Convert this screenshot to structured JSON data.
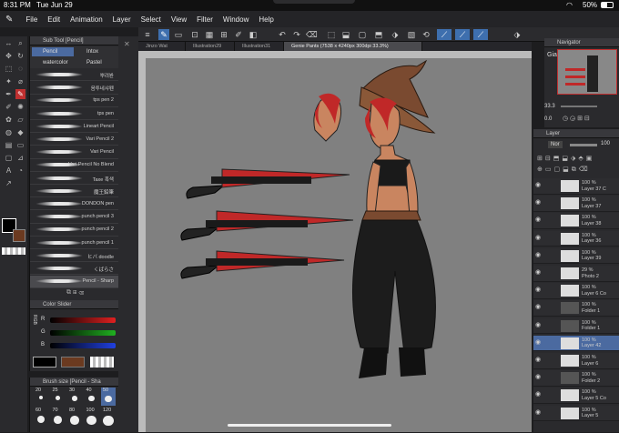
{
  "status": {
    "time": "8:31 PM",
    "date": "Tue Jun 29",
    "battery": "50%"
  },
  "menu": [
    "File",
    "Edit",
    "Animation",
    "Layer",
    "Select",
    "View",
    "Filter",
    "Window",
    "Help"
  ],
  "subtool": {
    "title": "Sub Tool [Pencil]",
    "tabs": [
      "Pencil",
      "Intox",
      "watercolor",
      "Pastel"
    ],
    "brushes": [
      "뿌려봔",
      "음투네샤펜",
      "tps pen 2",
      "tps pen",
      "Lineart Pencil",
      "Vari Pencil 2",
      "Vari Pencil",
      "Vari Pencil No Blend",
      "Taxe 흑색",
      "魔王鉛筆",
      "DONDON pen",
      "punch pencil 3",
      "punch pencil 2",
      "punch pencil 1",
      "ヒバ doodle",
      "くばらさ",
      "Pencil - Sharp"
    ]
  },
  "color_slider": {
    "title": "Color Slider",
    "labels": [
      "RGB",
      "R",
      "G",
      "B"
    ],
    "colors": {
      "r": "#e02020",
      "g": "#20b020",
      "b": "#2040e0"
    }
  },
  "brush_size": {
    "title": "Brush size [Pencil - Sha",
    "sizes": [
      "20",
      "25",
      "30",
      "40",
      "50",
      "60",
      "70",
      "80",
      "100",
      "120"
    ]
  },
  "tabs": [
    {
      "label": "Jinzo Wat"
    },
    {
      "label": "Illustration29"
    },
    {
      "label": "Illustration31"
    },
    {
      "label": "Genie Pants (7538 x 4240px 300dpi 33.3%)"
    }
  ],
  "navigator": {
    "title": "Navigator",
    "zoom": "33.3",
    "angle": "0.0",
    "label": "Gia"
  },
  "layer_panel": {
    "title": "Layer",
    "blend": "Nor",
    "opacity": "100",
    "layers": [
      {
        "pct": "100 %",
        "name": "Layer 37 C"
      },
      {
        "pct": "100 %",
        "name": "Layer 37"
      },
      {
        "pct": "100 %",
        "name": "Layer 38"
      },
      {
        "pct": "100 %",
        "name": "Layer 36"
      },
      {
        "pct": "100 %",
        "name": "Layer 39"
      },
      {
        "pct": "29 %",
        "name": "Photo 2"
      },
      {
        "pct": "100 %",
        "name": "Layer 6 Co"
      },
      {
        "pct": "100 %",
        "name": "Folder 1"
      },
      {
        "pct": "100 %",
        "name": "Folder 1"
      },
      {
        "pct": "100 %",
        "name": "Layer 42"
      },
      {
        "pct": "100 %",
        "name": "Layer 6"
      },
      {
        "pct": "100 %",
        "name": "Folder 2"
      },
      {
        "pct": "100 %",
        "name": "Layer 5 Co"
      },
      {
        "pct": "100 %",
        "name": "Layer 5"
      }
    ]
  }
}
